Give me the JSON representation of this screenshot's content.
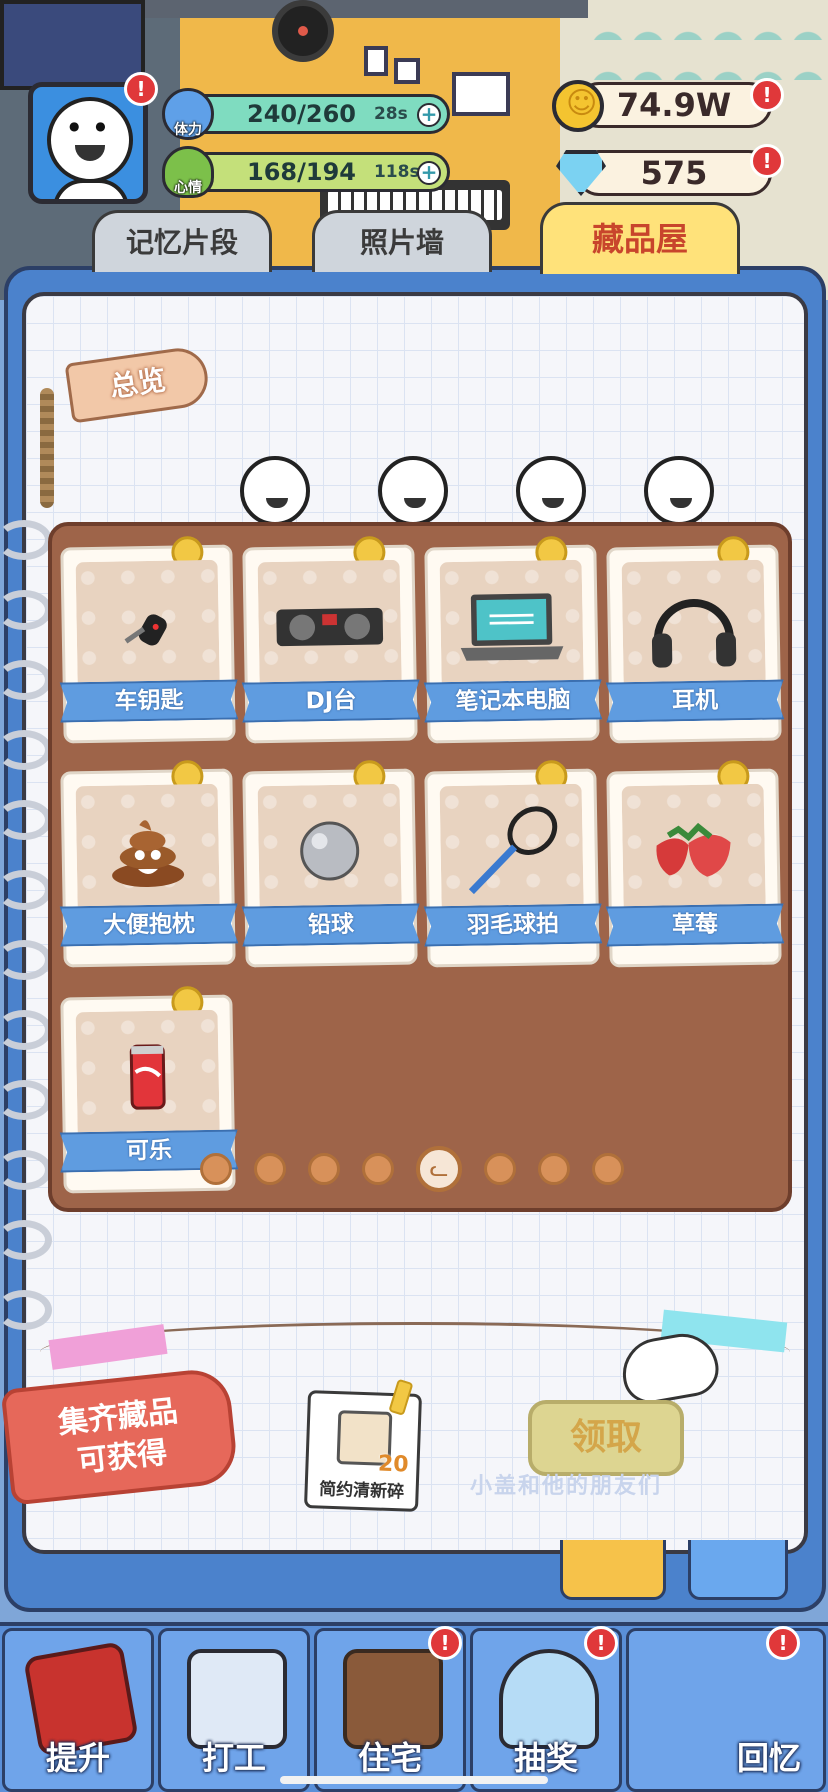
{
  "player": {
    "stamina": {
      "label": "体力",
      "value": "240/260",
      "timer": "28s",
      "plus": "+"
    },
    "mood": {
      "label": "心情",
      "value": "168/194",
      "timer": "118s",
      "plus": "+"
    }
  },
  "currency": {
    "coins": "74.9W",
    "gems": "575"
  },
  "alert_mark": "!",
  "tabs": [
    {
      "label": "记忆片段"
    },
    {
      "label": "照片墙"
    },
    {
      "label": "藏品屋"
    }
  ],
  "overview_label": "总览",
  "collection": [
    {
      "name": "车钥匙",
      "icon": "car-key"
    },
    {
      "name": "DJ台",
      "icon": "dj-turntable"
    },
    {
      "name": "笔记本电脑",
      "icon": "laptop"
    },
    {
      "name": "耳机",
      "icon": "headphones"
    },
    {
      "name": "大便抱枕",
      "icon": "poop-pillow"
    },
    {
      "name": "铅球",
      "icon": "shot-put"
    },
    {
      "name": "羽毛球拍",
      "icon": "badminton-racket"
    },
    {
      "name": "草莓",
      "icon": "strawberry"
    },
    {
      "name": "可乐",
      "icon": "cola-can"
    }
  ],
  "pagination": {
    "total": 8,
    "current": 5
  },
  "reward": {
    "label_line1": "集齐藏品",
    "label_line2": "可获得",
    "item_name": "简约清新碎",
    "item_qty": "20",
    "claim_label": "领取",
    "watermark": "小盖和他的朋友们"
  },
  "bottom_nav": [
    {
      "label": "提升",
      "icon": "book-icon"
    },
    {
      "label": "打工",
      "icon": "badge-icon"
    },
    {
      "label": "住宅",
      "icon": "house-icon"
    },
    {
      "label": "抽奖",
      "icon": "gacha-icon"
    },
    {
      "label": "回忆",
      "icon": "memory-icon"
    }
  ],
  "colors": {
    "accent": "#ffe27a",
    "ribbon": "#5f9ce0",
    "board": "#9e6449",
    "alert": "#e0383a"
  }
}
